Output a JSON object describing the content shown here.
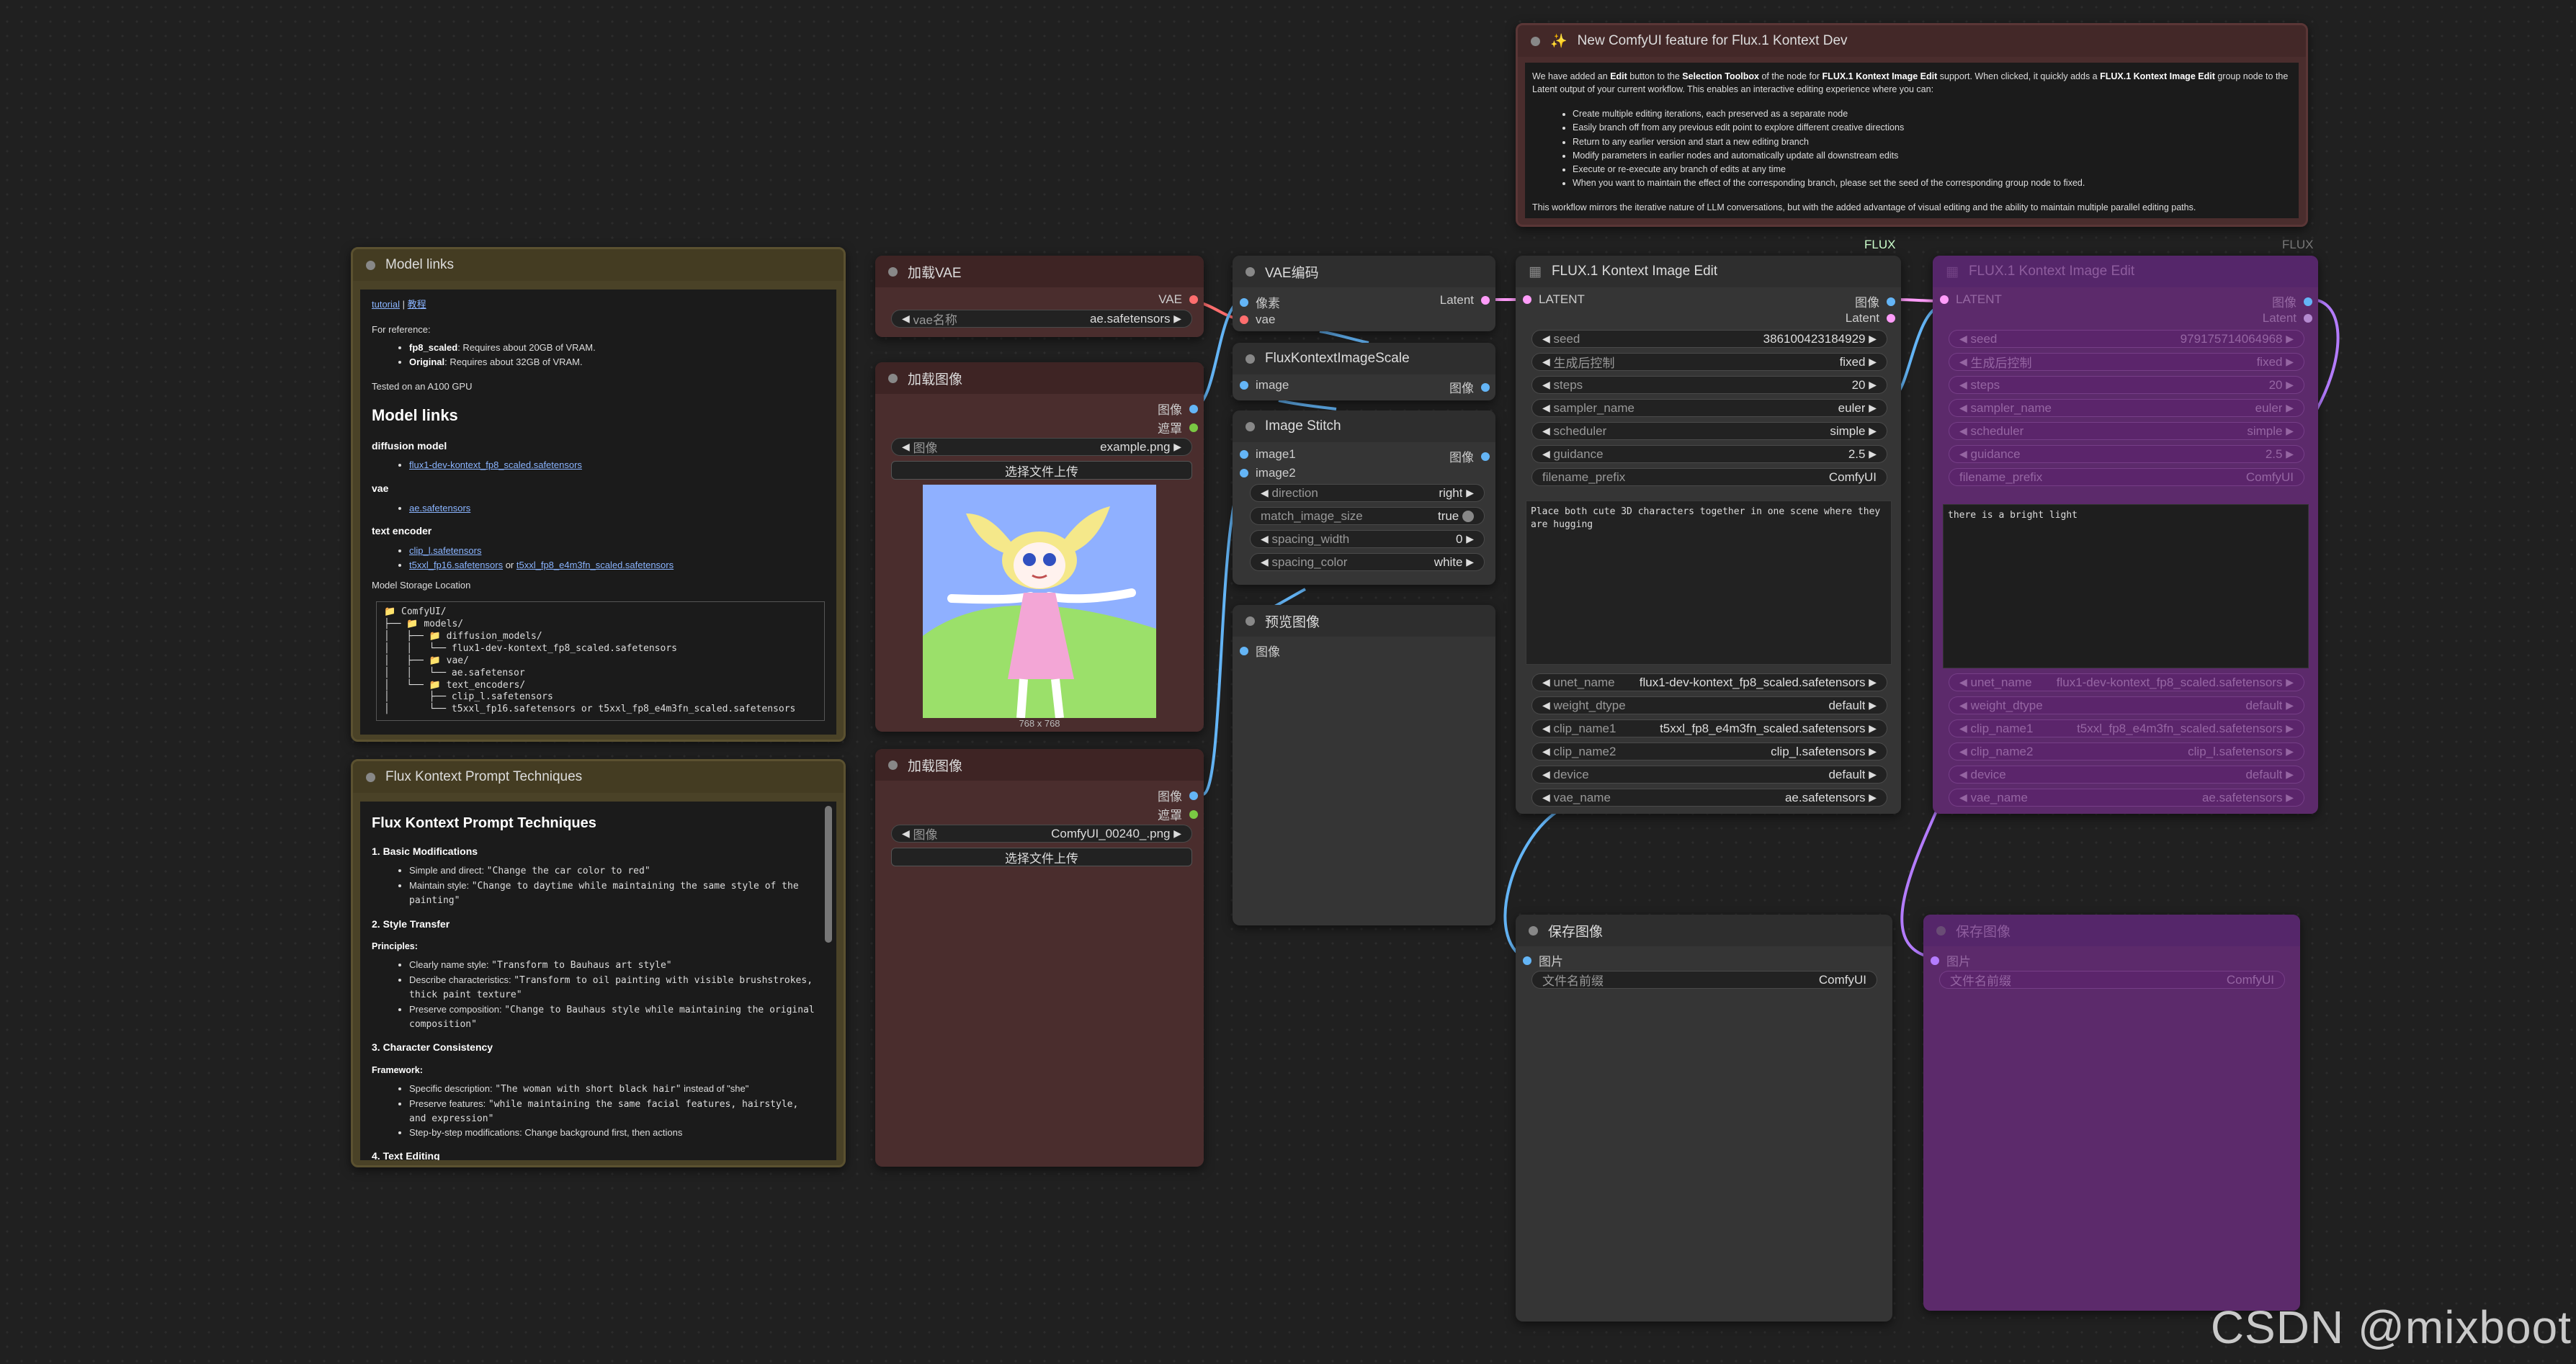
{
  "colors": {
    "canvas": "#202020",
    "note_olive": "#4a4227",
    "node_brown": "#4a2d2d",
    "node_gray": "#353535",
    "purple": "#5c2a6b",
    "latent_pin": "#ff9cf9",
    "image_pin": "#64b5f6",
    "vae_pin": "#ff6e6e"
  },
  "group_tags": {
    "flux_left": "FLUX",
    "flux_right": "FLUX"
  },
  "watermark": "CSDN @mixboot",
  "announcement": {
    "title": "New ComfyUI feature for Flux.1 Kontext Dev",
    "icon": "sparkles-icon",
    "p1_pre": "We have added an ",
    "p1_b1": "Edit",
    "p1_mid1": " button to the ",
    "p1_b2": "Selection Toolbox",
    "p1_mid2": " of the node for ",
    "p1_b3": "FLUX.1 Kontext Image Edit",
    "p1_mid3": " support. When clicked, it quickly adds a ",
    "p1_b4": "FLUX.1 Kontext Image Edit",
    "p1_post": " group node to the Latent output of your current workflow. This enables an interactive editing experience where you can:",
    "bullets": [
      "Create multiple editing iterations, each preserved as a separate node",
      "Easily branch off from any previous edit point to explore different creative directions",
      "Return to any earlier version and start a new editing branch",
      "Modify parameters in earlier nodes and automatically update all downstream edits",
      "Execute or re-execute any branch of edits at any time",
      "When you want to maintain the effect of the corresponding branch, please set the seed of the corresponding group node to fixed."
    ],
    "p2": "This workflow mirrors the iterative nature of LLM conversations, but with the added advantage of visual editing and the ability to maintain multiple parallel editing paths."
  },
  "model_links": {
    "title": "Model links",
    "link_tutorial": "tutorial",
    "sep": " | ",
    "link_cn": "教程",
    "for_ref": "For reference:",
    "req1_b": "fp8_scaled",
    "req1": ": Requires about 20GB of VRAM.",
    "req2_b": "Original",
    "req2": ": Requires about 32GB of VRAM.",
    "tested": "Tested on an A100 GPU",
    "heading": "Model links",
    "diff_h": "diffusion model",
    "diff_link": "flux1-dev-kontext_fp8_scaled.safetensors",
    "vae_h": "vae",
    "vae_link": "ae.safetensors",
    "te_h": "text encoder",
    "te_link1": "clip_l.safetensors",
    "te_link2": "t5xxl_fp16.safetensors",
    "te_or": " or ",
    "te_link3": "t5xxl_fp8_e4m3fn_scaled.safetensors",
    "storage": "Model Storage Location",
    "tree": "📁 ComfyUI/\n├── 📁 models/\n│   ├── 📁 diffusion_models/\n│   │   └── flux1-dev-kontext_fp8_scaled.safetensors\n│   ├── 📁 vae/\n│   │   └── ae.safetensor\n│   └── 📁 text_encoders/\n│       ├── clip_l.safetensors\n│       └── t5xxl_fp16.safetensors or t5xxl_fp8_e4m3fn_scaled.safetensors"
  },
  "prompt_tech": {
    "title": "Flux Kontext Prompt Techniques",
    "h1": "Flux Kontext Prompt Techniques",
    "s1": "1. Basic Modifications",
    "s1_items": [
      {
        "label": "Simple and direct: ",
        "code": "\"Change the car color to red\""
      },
      {
        "label": "Maintain style: ",
        "code": "\"Change to daytime while maintaining the same style of the painting\""
      }
    ],
    "s2": "2. Style Transfer",
    "principles": "Principles:",
    "s2_items": [
      {
        "label": "Clearly name style: ",
        "code": "\"Transform to Bauhaus art style\""
      },
      {
        "label": "Describe characteristics: ",
        "code": "\"Transform to oil painting with visible brushstrokes, thick paint texture\""
      },
      {
        "label": "Preserve composition: ",
        "code": "\"Change to Bauhaus style while maintaining the original composition\""
      }
    ],
    "s3": "3. Character Consistency",
    "framework": "Framework:",
    "s3_items": [
      {
        "label": "Specific description: ",
        "code": "\"The woman with short black hair\"",
        "post": " instead of \"she\""
      },
      {
        "label": "Preserve features: ",
        "code": "\"while maintaining the same facial features, hairstyle, and expression\"",
        "post": ""
      },
      {
        "label": "Step-by-step modifications: Change background first, then actions",
        "code": "",
        "post": ""
      }
    ],
    "s4": "4. Text Editing"
  },
  "load_vae": {
    "title": "加载VAE",
    "out": "VAE",
    "w_label": "vae名称",
    "w_value": "ae.safetensors"
  },
  "load_image1": {
    "title": "加载图像",
    "out1": "图像",
    "out2": "遮罩",
    "w_label": "图像",
    "w_value": "example.png",
    "upload": "选择文件上传",
    "size": "768 x 768"
  },
  "load_image2": {
    "title": "加载图像",
    "out1": "图像",
    "out2": "遮罩",
    "w_label": "图像",
    "w_value": "ComfyUI_00240_.png",
    "upload": "选择文件上传"
  },
  "vae_encode": {
    "title": "VAE编码",
    "in1": "像素",
    "in2": "vae",
    "out": "Latent"
  },
  "kontext_scale": {
    "title": "FluxKontextImageScale",
    "in": "image",
    "out": "图像"
  },
  "image_stitch": {
    "title": "Image Stitch",
    "in1": "image1",
    "in2": "image2",
    "out": "图像",
    "widgets": [
      {
        "label": "direction",
        "value": "right"
      },
      {
        "label": "match_image_size",
        "value": "true"
      },
      {
        "label": "spacing_width",
        "value": "0"
      },
      {
        "label": "spacing_color",
        "value": "white"
      }
    ]
  },
  "preview": {
    "title": "预览图像",
    "in": "图像"
  },
  "kontext_edit": {
    "title": "FLUX.1 Kontext Image Edit",
    "in": "LATENT",
    "out1": "图像",
    "out2": "Latent",
    "widgets": [
      {
        "label": "seed",
        "value": "386100423184929"
      },
      {
        "label": "生成后控制",
        "value": "fixed"
      },
      {
        "label": "steps",
        "value": "20"
      },
      {
        "label": "sampler_name",
        "value": "euler"
      },
      {
        "label": "scheduler",
        "value": "simple"
      },
      {
        "label": "guidance",
        "value": "2.5"
      },
      {
        "label": "filename_prefix",
        "value": "ComfyUI"
      }
    ],
    "prompt": "Place both cute 3D characters together in one scene where they are hugging",
    "widgets2": [
      {
        "label": "unet_name",
        "value": "flux1-dev-kontext_fp8_scaled.safetensors"
      },
      {
        "label": "weight_dtype",
        "value": "default"
      },
      {
        "label": "clip_name1",
        "value": "t5xxl_fp8_e4m3fn_scaled.safetensors"
      },
      {
        "label": "clip_name2",
        "value": "clip_l.safetensors"
      },
      {
        "label": "device",
        "value": "default"
      },
      {
        "label": "vae_name",
        "value": "ae.safetensors"
      }
    ]
  },
  "kontext_edit2": {
    "title": "FLUX.1 Kontext Image Edit",
    "in": "LATENT",
    "out1": "图像",
    "out2": "Latent",
    "widgets": [
      {
        "label": "seed",
        "value": "979175714064968"
      },
      {
        "label": "生成后控制",
        "value": "fixed"
      },
      {
        "label": "steps",
        "value": "20"
      },
      {
        "label": "sampler_name",
        "value": "euler"
      },
      {
        "label": "scheduler",
        "value": "simple"
      },
      {
        "label": "guidance",
        "value": "2.5"
      },
      {
        "label": "filename_prefix",
        "value": "ComfyUI"
      }
    ],
    "prompt": "there is a bright light",
    "widgets2": [
      {
        "label": "unet_name",
        "value": "flux1-dev-kontext_fp8_scaled.safetensors"
      },
      {
        "label": "weight_dtype",
        "value": "default"
      },
      {
        "label": "clip_name1",
        "value": "t5xxl_fp8_e4m3fn_scaled.safetensors"
      },
      {
        "label": "clip_name2",
        "value": "clip_l.safetensors"
      },
      {
        "label": "device",
        "value": "default"
      },
      {
        "label": "vae_name",
        "value": "ae.safetensors"
      }
    ]
  },
  "save1": {
    "title": "保存图像",
    "in": "图片",
    "w_label": "文件名前缀",
    "w_value": "ComfyUI"
  },
  "save2": {
    "title": "保存图像",
    "in": "图片",
    "w_label": "文件名前缀",
    "w_value": "ComfyUI"
  }
}
